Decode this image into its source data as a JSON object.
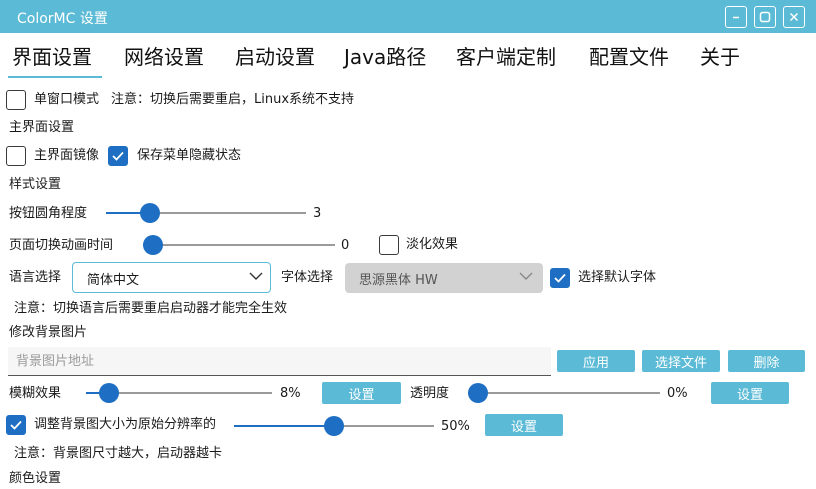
{
  "window": {
    "title": "ColorMC 设置"
  },
  "tabs": [
    {
      "label": "界面设置",
      "active": true
    },
    {
      "label": "网络设置"
    },
    {
      "label": "启动设置"
    },
    {
      "label": "Java路径"
    },
    {
      "label": "客户端定制"
    },
    {
      "label": "配置文件"
    },
    {
      "label": "关于"
    }
  ],
  "settings": {
    "single_window": {
      "label": "单窗口模式",
      "checked": false,
      "note": "注意：切换后需要重启，Linux系统不支持"
    },
    "main_section": "主界面设置",
    "main_mirror": {
      "label": "主界面镜像",
      "checked": false
    },
    "save_menu_hidden": {
      "label": "保存菜单隐藏状态",
      "checked": true
    },
    "style_section": "样式设置",
    "button_radius": {
      "label": "按钮圆角程度",
      "value": "3",
      "fraction": 0.19
    },
    "page_anim": {
      "label": "页面切换动画时间",
      "value": "0",
      "fraction": 0.0
    },
    "fade_effect": {
      "label": "淡化效果",
      "checked": false
    },
    "language": {
      "label": "语言选择",
      "selected": "简体中文"
    },
    "font": {
      "label": "字体选择",
      "selected": "思源黑体 HW",
      "disabled": true
    },
    "default_font": {
      "label": "选择默认字体",
      "checked": true
    },
    "language_note": "注意：切换语言后需要重启启动器才能完全生效",
    "bg_section": "修改背景图片",
    "bg_path": {
      "placeholder": "背景图片地址",
      "value": ""
    },
    "bg_buttons": {
      "apply": "应用",
      "choose": "选择文件",
      "delete": "删除"
    },
    "blur": {
      "label": "模糊效果",
      "value": "8%",
      "fraction": 0.08,
      "button": "设置"
    },
    "opacity": {
      "label": "透明度",
      "value": "0%",
      "fraction": 0.0,
      "button": "设置"
    },
    "resize_bg": {
      "label": "调整背景图大小为原始分辨率的",
      "checked": true,
      "value": "50%",
      "fraction": 0.5,
      "button": "设置"
    },
    "bg_note": "注意：背景图尺寸越大，启动器越卡",
    "color_section": "颜色设置"
  },
  "colors": {
    "accent": "#5bbad5",
    "primary": "#1e6fc3"
  }
}
